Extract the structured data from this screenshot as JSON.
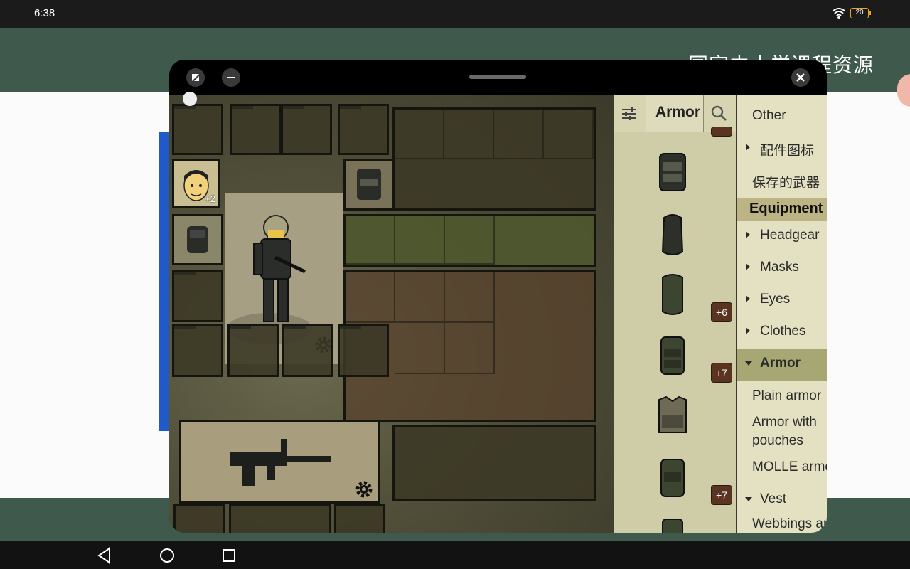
{
  "status_bar": {
    "time": "6:38",
    "battery": "20"
  },
  "background": {
    "title": "国家中小学课程资源"
  },
  "window": {
    "portrait_bonus": "+2",
    "items": [
      {
        "icon": "armor-item-1-icon"
      },
      {
        "icon": "armor-item-2-icon",
        "badge": ""
      },
      {
        "icon": "armor-item-3-icon",
        "badge": "+6"
      },
      {
        "icon": "armor-item-4-icon",
        "badge": "+7"
      },
      {
        "icon": "armor-item-5-icon",
        "badge": ""
      },
      {
        "icon": "armor-item-6-icon",
        "badge": "+7"
      }
    ],
    "search_text": "Armor",
    "categories": [
      {
        "label": "Other"
      },
      {
        "label": "配件图标"
      },
      {
        "label": "保存的武器"
      },
      {
        "label": "Equipment"
      },
      {
        "label": "Headgear"
      },
      {
        "label": "Masks"
      },
      {
        "label": "Eyes"
      },
      {
        "label": "Clothes"
      },
      {
        "label": "Armor"
      },
      {
        "label": "Plain armor"
      },
      {
        "label": "Armor with pouches"
      },
      {
        "label": "MOLLE armor"
      },
      {
        "label": "Vest"
      },
      {
        "label": "Webbings and"
      }
    ]
  },
  "colors": {
    "accent_green": "#3f5a4c",
    "badge_brown": "#5a3421",
    "selected": "#a7a774"
  }
}
